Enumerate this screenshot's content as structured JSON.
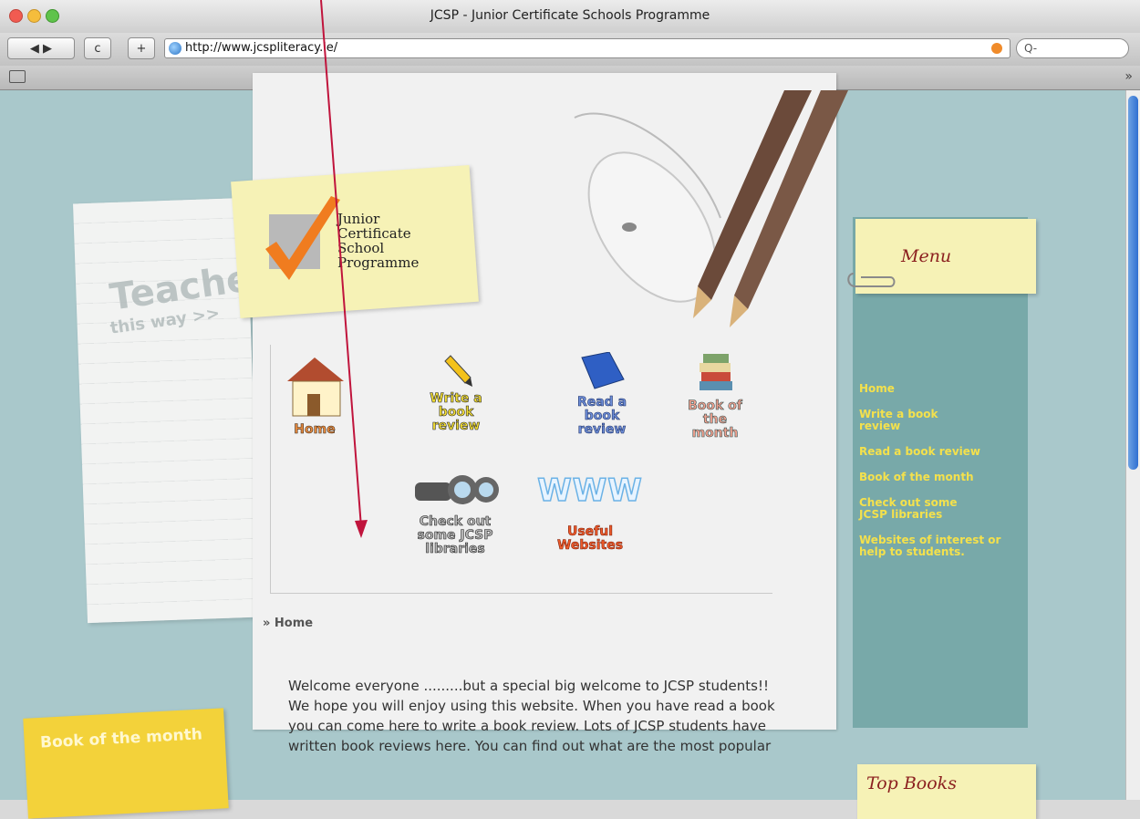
{
  "window": {
    "title": "JCSP - Junior Certificate Schools Programme"
  },
  "toolbar": {
    "back_icon": "back-forward-icon",
    "reload_label": "c",
    "add_label": "+",
    "url": "http://www.jcspliteracy.ie/",
    "search_placeholder": "Q-"
  },
  "bookmarks": {
    "book_icon": "book-icon",
    "overflow_label": "»"
  },
  "logo": {
    "lines": [
      "Junior",
      "Certificate",
      "School",
      "Programme"
    ]
  },
  "nav": {
    "items": [
      {
        "label": "Home",
        "icon": "house-icon",
        "color": "#e88b3f"
      },
      {
        "label": "Write a book review",
        "icon": "pencil-icon",
        "color": "#f4df35"
      },
      {
        "label": "Read a book review",
        "icon": "blue-book-icon",
        "color": "#6f8fd9"
      },
      {
        "label": "Book of the month",
        "icon": "book-stack-icon",
        "color": "#f2a18f"
      },
      {
        "label": "Check out some JCSP libraries",
        "icon": "binoculars-icon",
        "color": "#b7b7b7"
      },
      {
        "label": "Useful Websites",
        "icon": "www-icon",
        "color": "#ef5a2a"
      }
    ]
  },
  "breadcrumb": "» Home",
  "welcome": {
    "text": "Welcome everyone .........but a special big welcome to JCSP students!! We hope you will enjoy using this website. When you have read a book you can come here to write a book review. Lots of JCSP students have written book reviews here. You can find out what are the most popular"
  },
  "sidebar": {
    "teachers_label": "Teachers",
    "teachers_sub": "this way >>",
    "book_of_month_title": "Book of the month"
  },
  "menu": {
    "title": "Menu",
    "items": [
      "Home",
      "Write a book review",
      "Read a book review",
      "Book of the month",
      "Check out some JCSP libraries",
      "Websites of interest or help to students."
    ],
    "link_color": "#f4e14c"
  },
  "top_books": {
    "title": "Top Books"
  },
  "colors": {
    "page_bg": "#a9c8cb",
    "menu_panel": "#78a9a9",
    "annotation_arrow": "#c0143c"
  }
}
